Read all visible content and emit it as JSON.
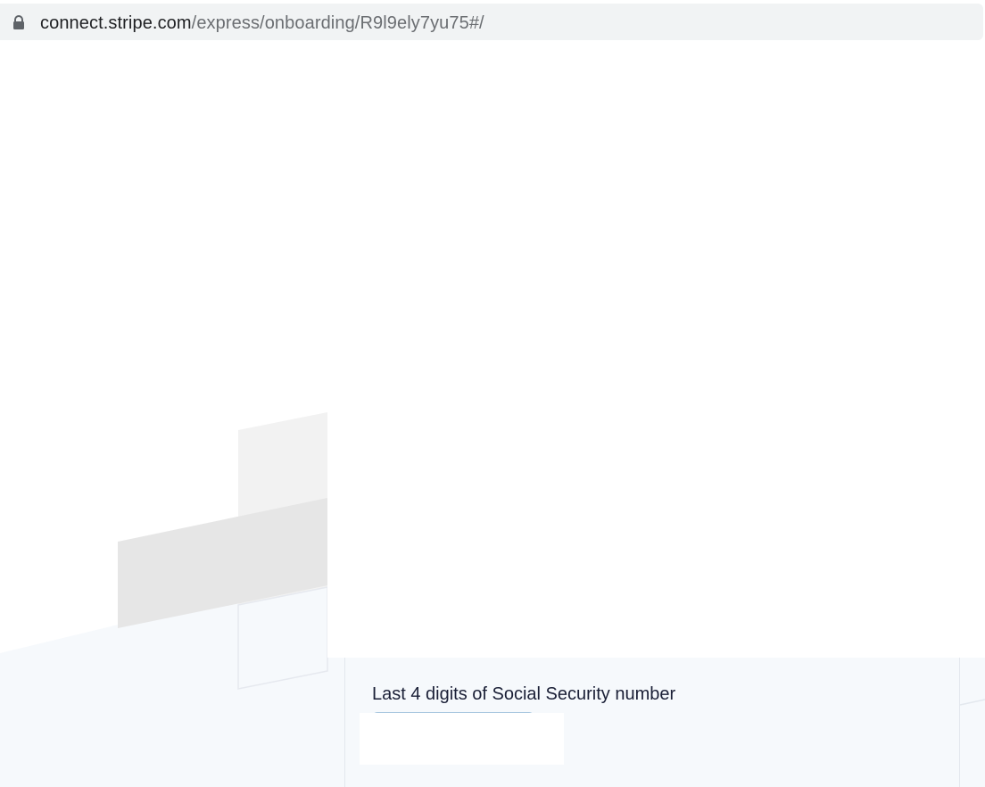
{
  "browser": {
    "url_host": "connect.stripe.com",
    "url_path": "/express/onboarding/R9l9ely7yu75#/",
    "lock_icon": "lock-icon"
  },
  "form": {
    "ssn_label": "Last 4 digits of Social Security number",
    "ssn_value": "",
    "ssn_placeholder": ""
  },
  "colors": {
    "card_background": "#f6f9fc",
    "label_text": "#1a1f36",
    "background_shapes": [
      "#f2f2f2",
      "#e6e6e6",
      "#f6f9fc"
    ]
  }
}
